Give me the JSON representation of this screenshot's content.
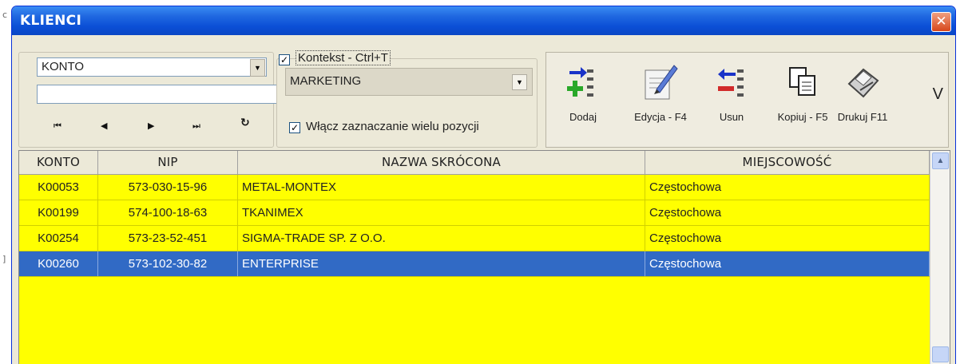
{
  "window": {
    "title": "KLIENCI",
    "close_icon": "close-icon"
  },
  "search": {
    "field_value": "KONTO",
    "query_value": ""
  },
  "navigation": {
    "first": "⏮",
    "prev": "◀",
    "next": "▶",
    "last": "⏭",
    "refresh": "↻"
  },
  "context": {
    "kontekst_label": "Kontekst - Ctrl+T",
    "kontekst_checked": true,
    "selected_context": "MARKETING",
    "multi_select_label": "Włącz zaznaczanie wielu pozycji",
    "multi_select_checked": true
  },
  "actions": {
    "add_label": "Dodaj",
    "edit_label": "Edycja - F4",
    "delete_label": "Usun",
    "copy_label": "Kopiuj - F5",
    "print_label": "Drukuj F11",
    "more_label": "V"
  },
  "table": {
    "headers": {
      "konto": "KONTO",
      "nip": "NIP",
      "nazwa": "NAZWA SKRÓCONA",
      "miasto": "MIEJSCOWOŚĆ"
    },
    "rows": [
      {
        "konto": "K00053",
        "nip": "573-030-15-96",
        "nazwa": "METAL-MONTEX",
        "miasto": "Częstochowa"
      },
      {
        "konto": "K00199",
        "nip": "574-100-18-63",
        "nazwa": "TKANIMEX",
        "miasto": "Częstochowa"
      },
      {
        "konto": "K00254",
        "nip": "573-23-52-451",
        "nazwa": "SIGMA-TRADE SP. Z O.O.",
        "miasto": "Częstochowa"
      },
      {
        "konto": "K00260",
        "nip": "573-102-30-82",
        "nazwa": "ENTERPRISE",
        "miasto": "Częstochowa"
      }
    ],
    "selected_row": 3
  },
  "colors": {
    "grid_background": "#ffff00",
    "selection": "#316ac5",
    "titlebar": "#0b4fd6"
  }
}
